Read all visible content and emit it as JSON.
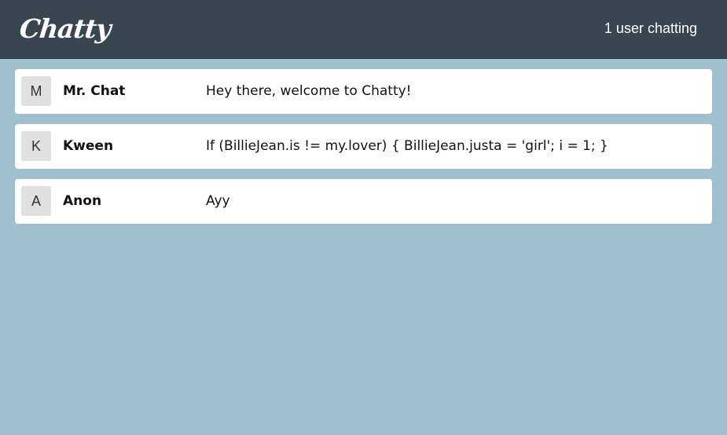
{
  "navbar": {
    "brand": "Chatty",
    "user_count": "1 user chatting"
  },
  "messages": [
    {
      "avatar": "M",
      "username": "Mr. Chat",
      "content": "Hey there, welcome to Chatty!"
    },
    {
      "avatar": "K",
      "username": "Kween",
      "content": "If (BillieJean.is != my.lover) { BillieJean.justa = 'girl'; i = 1; }"
    },
    {
      "avatar": "A",
      "username": "Anon",
      "content": "Ayy"
    }
  ]
}
